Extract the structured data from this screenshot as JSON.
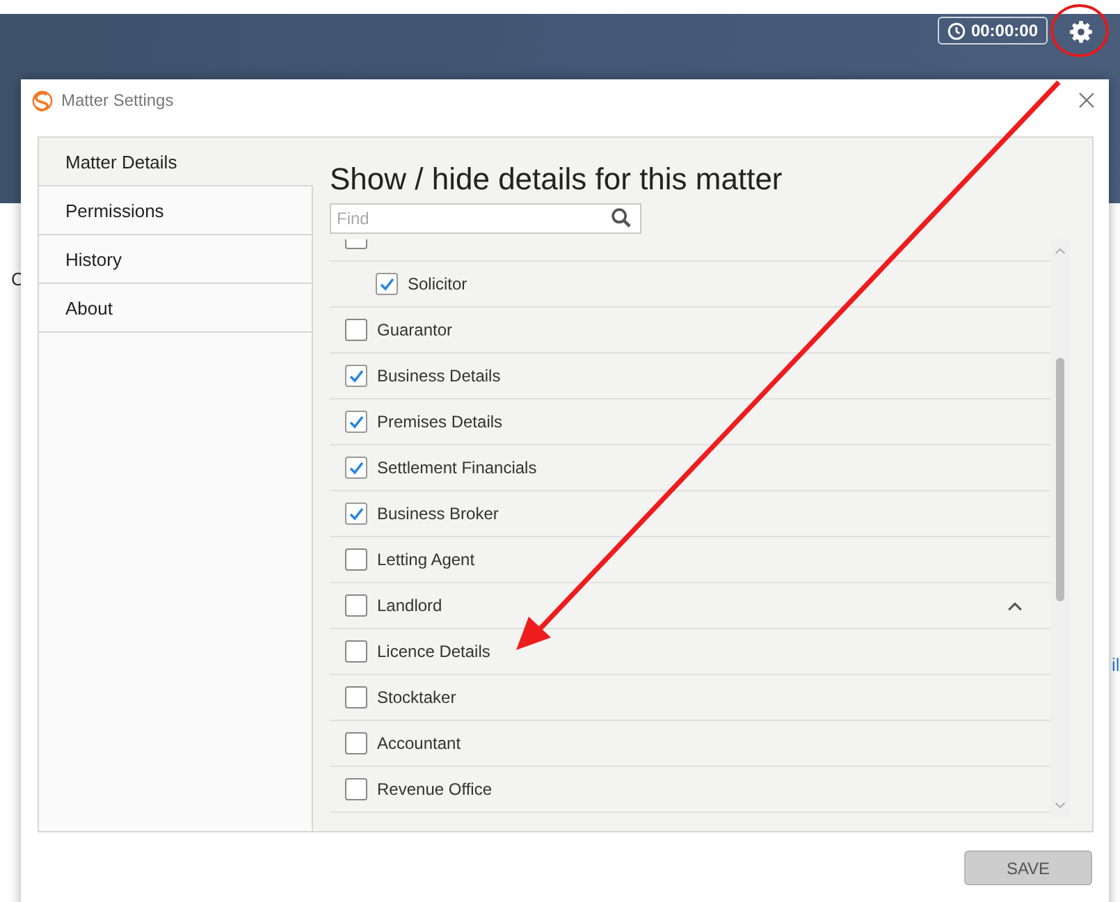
{
  "header": {
    "timer": "00:00:00"
  },
  "background": {
    "left_fragment": "C",
    "right_fragment": "il"
  },
  "dialog": {
    "title": "Matter Settings",
    "sidebar": {
      "items": [
        {
          "label": "Matter Details",
          "selected": true
        },
        {
          "label": "Permissions",
          "selected": false
        },
        {
          "label": "History",
          "selected": false
        },
        {
          "label": "About",
          "selected": false
        }
      ]
    },
    "heading": "Show / hide details for this matter",
    "search": {
      "placeholder": "Find"
    },
    "items": [
      {
        "checked": false,
        "children": [
          {
            "label": "Solicitor",
            "checked": true
          }
        ]
      },
      {
        "label": "Guarantor",
        "checked": false
      },
      {
        "label": "Business Details",
        "checked": true
      },
      {
        "label": "Premises Details",
        "checked": true
      },
      {
        "label": "Settlement Financials",
        "checked": true
      },
      {
        "label": "Business Broker",
        "checked": true
      },
      {
        "label": "Letting Agent",
        "checked": false
      },
      {
        "label": "Landlord",
        "checked": false,
        "expanded": true
      },
      {
        "label": "Licence Details",
        "checked": false
      },
      {
        "label": "Stocktaker",
        "checked": false
      },
      {
        "label": "Accountant",
        "checked": false
      },
      {
        "label": "Revenue Office",
        "checked": false
      }
    ],
    "save_button": {
      "label": "SAVE",
      "disabled": true
    }
  }
}
